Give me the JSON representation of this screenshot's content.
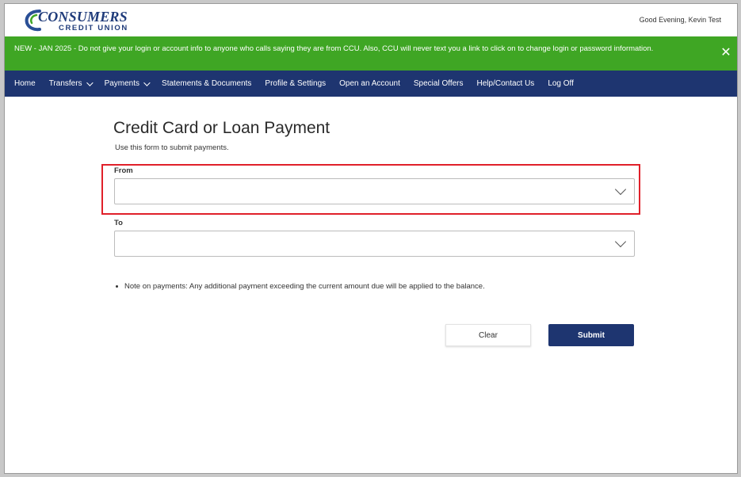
{
  "header": {
    "logo_name": "CONSUMERS",
    "logo_sub": "CREDIT UNION",
    "greeting": "Good Evening, Kevin Test"
  },
  "alert": {
    "text": "NEW - JAN 2025 - Do not give your login or account info to anyone who calls saying they are from CCU. Also, CCU will never text you a link to click on to change login or password information.",
    "close_icon": "close-icon"
  },
  "nav": {
    "items": [
      {
        "label": "Home",
        "dropdown": false
      },
      {
        "label": "Transfers",
        "dropdown": true
      },
      {
        "label": "Payments",
        "dropdown": true
      },
      {
        "label": "Statements & Documents",
        "dropdown": false
      },
      {
        "label": "Profile & Settings",
        "dropdown": false
      },
      {
        "label": "Open an Account",
        "dropdown": false
      },
      {
        "label": "Special Offers",
        "dropdown": false
      },
      {
        "label": "Help/Contact Us",
        "dropdown": false
      },
      {
        "label": "Log Off",
        "dropdown": false
      }
    ]
  },
  "form": {
    "title": "Credit Card or Loan Payment",
    "subtitle": "Use this form to submit payments.",
    "from_label": "From",
    "from_value": "",
    "to_label": "To",
    "to_value": "",
    "note": "Note on payments: Any additional payment exceeding the current amount due will be applied to the balance.",
    "clear_label": "Clear",
    "submit_label": "Submit"
  },
  "colors": {
    "alert_bg": "#3fa624",
    "nav_bg": "#1e3570",
    "highlight": "#e0202a",
    "submit_bg": "#1e3570"
  }
}
